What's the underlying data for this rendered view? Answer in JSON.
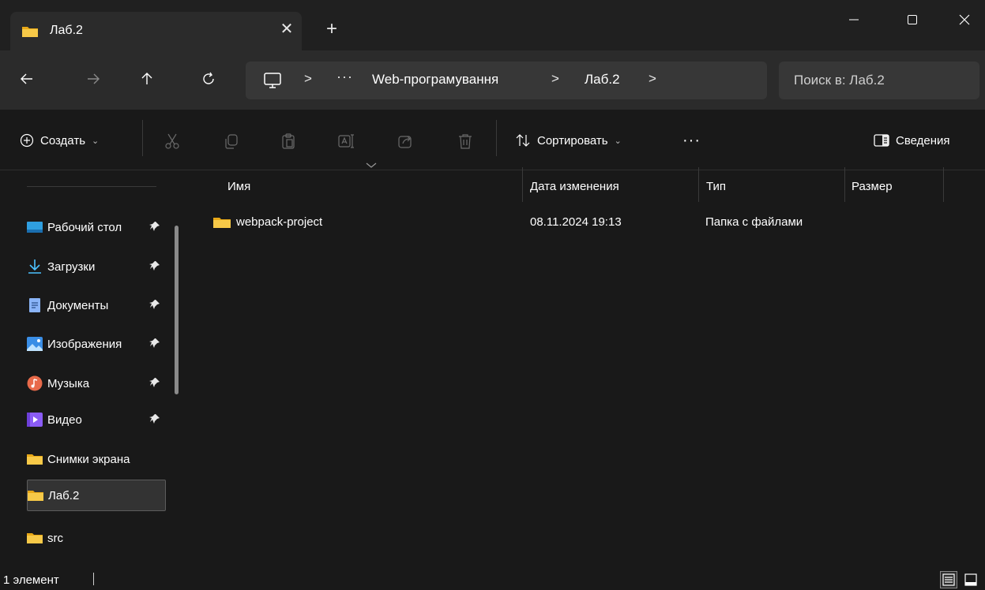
{
  "tab": {
    "title": "Лаб.2",
    "close": "✕",
    "new": "+"
  },
  "address": {
    "more": "···",
    "separator": ">",
    "breadcrumbs": [
      "Web-програмування",
      "Лаб.2"
    ]
  },
  "search": {
    "placeholder": "Поиск в: Лаб.2"
  },
  "commands": {
    "create": "Создать",
    "sort": "Сортировать",
    "more": "···",
    "details": "Сведения"
  },
  "sidebar": {
    "items": [
      {
        "label": "Рабочий стол",
        "icon": "desktop-icon",
        "pinned": true
      },
      {
        "label": "Загрузки",
        "icon": "download-icon",
        "pinned": true
      },
      {
        "label": "Документы",
        "icon": "document-icon",
        "pinned": true
      },
      {
        "label": "Изображения",
        "icon": "image-icon",
        "pinned": true
      },
      {
        "label": "Музыка",
        "icon": "music-icon",
        "pinned": true
      },
      {
        "label": "Видео",
        "icon": "video-icon",
        "pinned": true
      },
      {
        "label": "Снимки экрана",
        "icon": "folder-icon",
        "pinned": false
      },
      {
        "label": "Лаб.2",
        "icon": "folder-icon",
        "pinned": false,
        "selected": true
      },
      {
        "label": "src",
        "icon": "folder-icon",
        "pinned": false
      }
    ]
  },
  "columns": {
    "name": "Имя",
    "date": "Дата изменения",
    "type": "Тип",
    "size": "Размер"
  },
  "files": [
    {
      "name": "webpack-project",
      "date": "08.11.2024 19:13",
      "type": "Папка с файлами",
      "size": ""
    }
  ],
  "status": {
    "count": "1 элемент"
  },
  "colors": {
    "folder": "#f0c419",
    "background": "#191919",
    "panel": "#2b2b2b",
    "field": "#373737"
  }
}
